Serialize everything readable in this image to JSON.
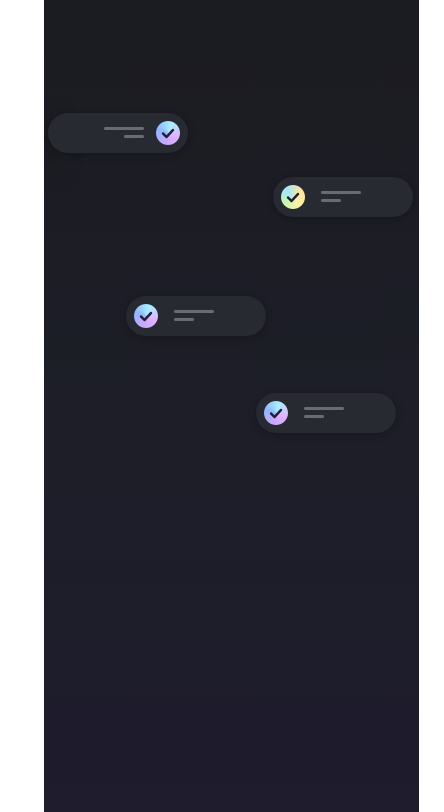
{
  "icons": {
    "check": "check-icon"
  },
  "colors": {
    "background_top": "#1b1c21",
    "background_bottom": "#1e1c2d",
    "pill": "#282a31",
    "placeholder_line": "#6a6c74",
    "check_mark": "#1f2030"
  },
  "notifications": [
    {
      "id": "notification-1",
      "icon_style": "gradient-purple"
    },
    {
      "id": "notification-2",
      "icon_style": "gradient-yellow"
    },
    {
      "id": "notification-3",
      "icon_style": "gradient-purple"
    },
    {
      "id": "notification-4",
      "icon_style": "gradient-purple"
    }
  ]
}
